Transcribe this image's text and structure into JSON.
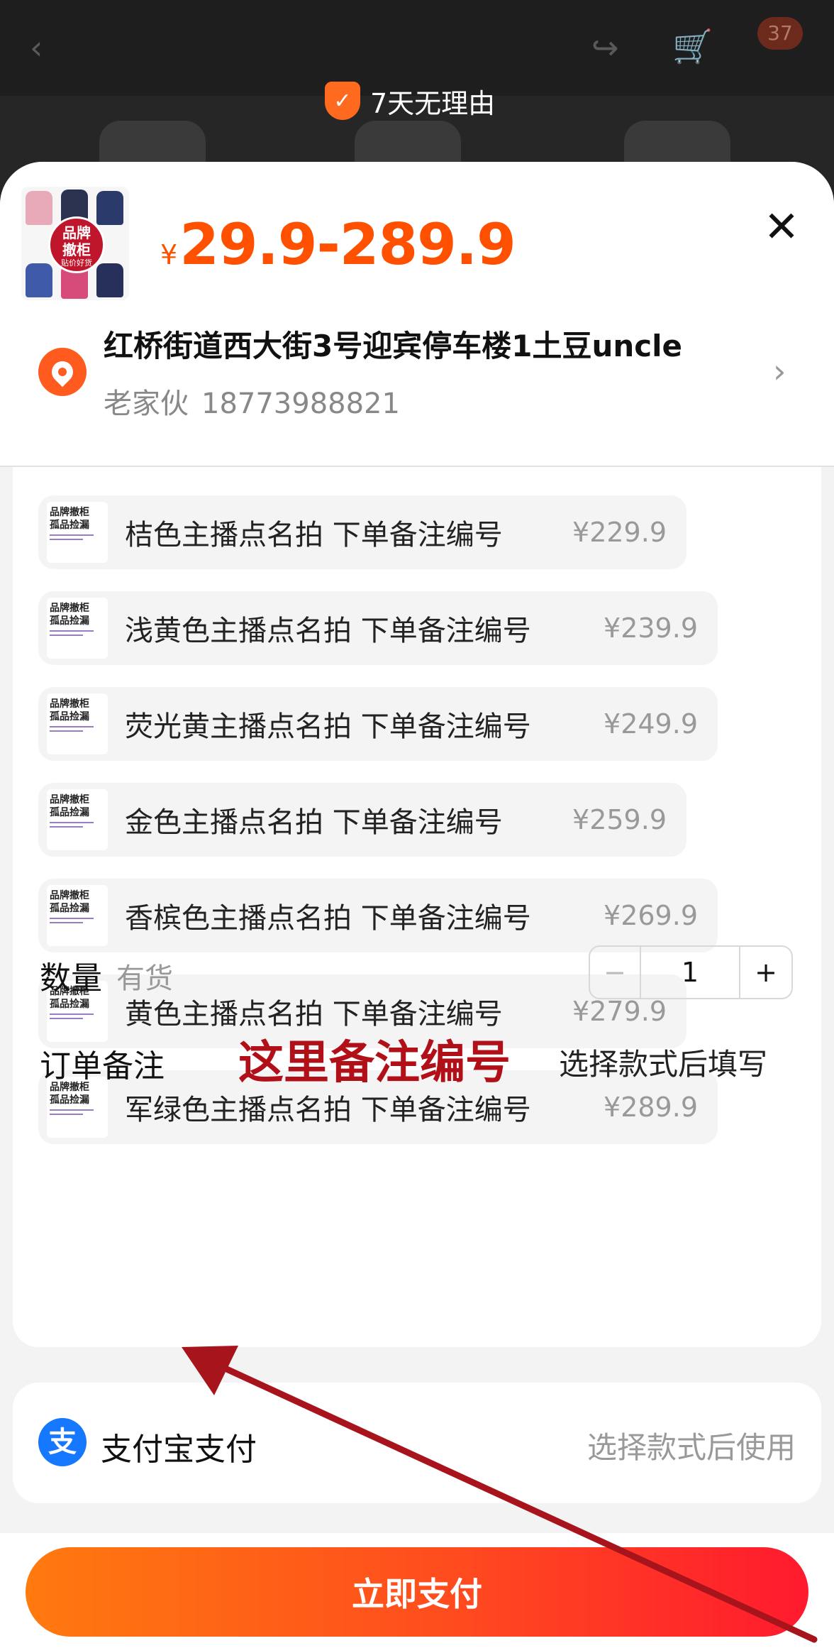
{
  "background": {
    "cart_count": "37",
    "return_policy": "7天无理由"
  },
  "sheet": {
    "price": {
      "currency": "¥",
      "range": "29.9-289.9"
    },
    "thumbnail_seal": {
      "line1": "品牌",
      "line2": "撤柜",
      "line3": "贴价好货"
    },
    "address": {
      "line": "红桥街道西大街3号迎宾停车楼1土豆uncle",
      "name": "老家伙",
      "phone": "18773988821"
    },
    "options": [
      {
        "label": "桔色主播点名拍 下单备注编号",
        "price": "¥229.9"
      },
      {
        "label": "浅黄色主播点名拍 下单备注编号",
        "price": "¥239.9"
      },
      {
        "label": "荧光黄主播点名拍 下单备注编号",
        "price": "¥249.9"
      },
      {
        "label": "金色主播点名拍 下单备注编号",
        "price": "¥259.9"
      },
      {
        "label": "香槟色主播点名拍 下单备注编号",
        "price": "¥269.9"
      },
      {
        "label": "黄色主播点名拍 下单备注编号",
        "price": "¥279.9"
      },
      {
        "label": "军绿色主播点名拍 下单备注编号",
        "price": "¥289.9"
      }
    ],
    "option_image_text": {
      "line1": "品牌撤柜",
      "line2": "孤品捡漏"
    },
    "quantity": {
      "title": "数量",
      "stock": "有货",
      "minus": "−",
      "value": "1",
      "plus": "+"
    },
    "remark": {
      "title": "订单备注",
      "annotation": "这里备注编号",
      "hint": "选择款式后填写"
    },
    "payment": {
      "method": "支付宝支付",
      "icon_char": "支",
      "hint": "选择款式后使用"
    },
    "pay_button": "立即支付"
  },
  "colors": {
    "accent": "#ff5000",
    "annotation_red": "#b21019",
    "alipay_blue": "#1677ff"
  },
  "icons": [
    "back-icon",
    "share-icon",
    "cart-icon",
    "shield-check-icon",
    "close-icon",
    "location-pin-icon",
    "chevron-right-icon",
    "alipay-icon",
    "annotation-arrow"
  ]
}
